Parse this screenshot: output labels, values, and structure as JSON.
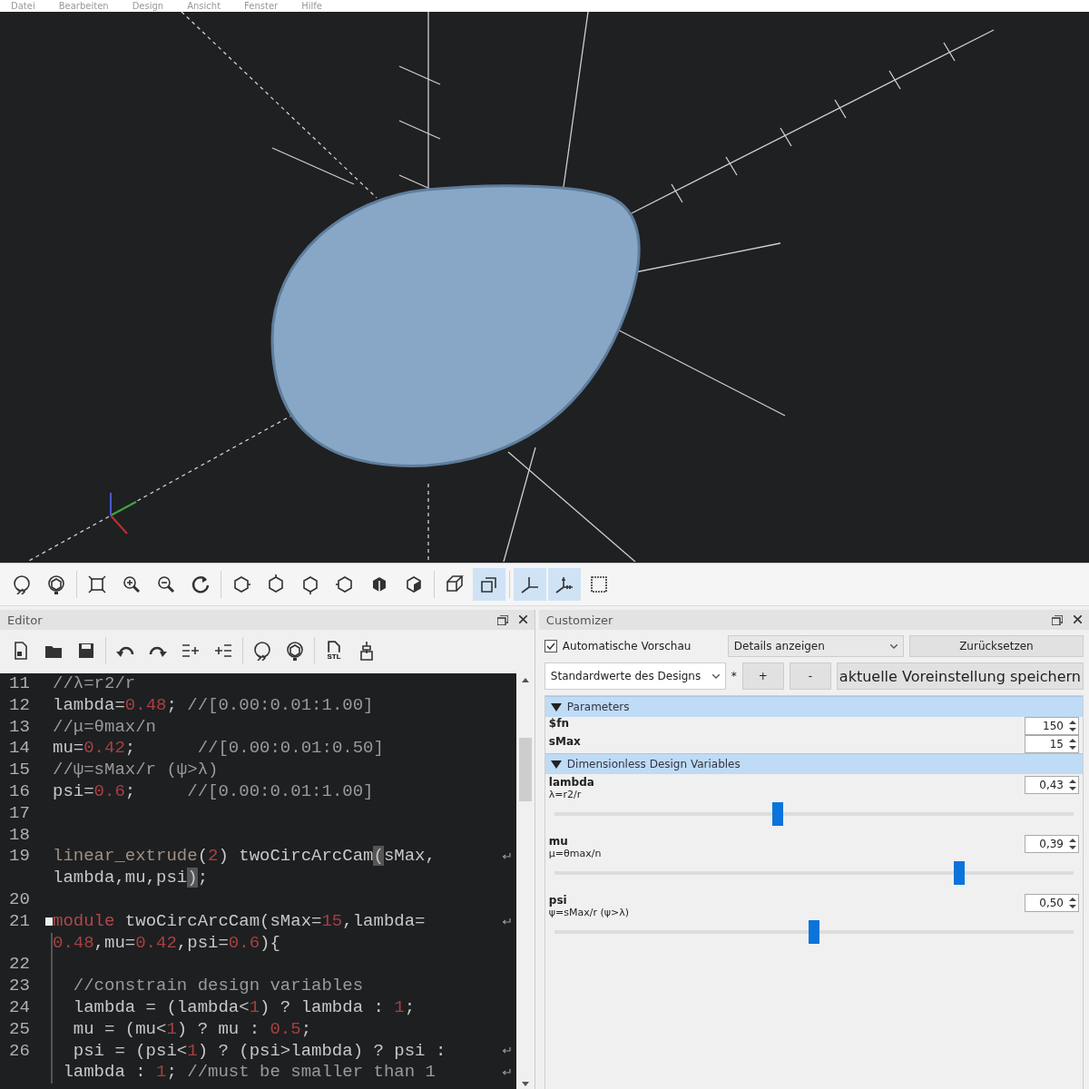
{
  "menu": [
    "Datei",
    "Bearbeiten",
    "Design",
    "Ansicht",
    "Fenster",
    "Hilfe"
  ],
  "main_toolbar": [
    [
      {
        "kind": "preview",
        "selected": false
      },
      {
        "kind": "render",
        "selected": false
      }
    ],
    [
      {
        "kind": "view-all",
        "selected": false
      },
      {
        "kind": "zoom-in",
        "selected": false
      },
      {
        "kind": "zoom-out",
        "selected": false
      },
      {
        "kind": "reset-view",
        "selected": false
      }
    ],
    [
      {
        "kind": "view-right",
        "selected": false
      },
      {
        "kind": "view-top",
        "selected": false
      },
      {
        "kind": "view-bottom",
        "selected": false
      },
      {
        "kind": "view-left",
        "selected": false
      },
      {
        "kind": "view-front",
        "selected": false
      },
      {
        "kind": "view-back",
        "selected": false
      }
    ],
    [
      {
        "kind": "perspective",
        "selected": false
      },
      {
        "kind": "orthogonal",
        "selected": true
      }
    ],
    [
      {
        "kind": "axes",
        "selected": true
      },
      {
        "kind": "scale-markers",
        "selected": true
      },
      {
        "kind": "edges",
        "selected": false
      }
    ]
  ],
  "editor": {
    "title": "Editor",
    "toolbar": [
      [
        {
          "kind": "new"
        },
        {
          "kind": "open"
        },
        {
          "kind": "save"
        }
      ],
      [
        {
          "kind": "undo"
        },
        {
          "kind": "redo"
        },
        {
          "kind": "unindent"
        },
        {
          "kind": "indent"
        }
      ],
      [
        {
          "kind": "preview"
        },
        {
          "kind": "render"
        }
      ],
      [
        {
          "kind": "export",
          "label": "STL"
        },
        {
          "kind": "print"
        }
      ]
    ],
    "lines": [
      {
        "number": "11",
        "rows": [
          {
            "tokens": [
              {
                "kind": "comment",
                "text": "//λ=r2/r"
              }
            ]
          }
        ]
      },
      {
        "number": "12",
        "rows": [
          {
            "tokens": [
              {
                "kind": "plain",
                "text": "lambda="
              },
              {
                "kind": "number",
                "text": "0.48"
              },
              {
                "kind": "plain",
                "text": "; "
              },
              {
                "kind": "comment",
                "text": "//[0.00:0.01:1.00]"
              }
            ]
          }
        ]
      },
      {
        "number": "13",
        "rows": [
          {
            "tokens": [
              {
                "kind": "comment",
                "text": "//μ=θmax/n"
              }
            ]
          }
        ]
      },
      {
        "number": "14",
        "rows": [
          {
            "tokens": [
              {
                "kind": "plain",
                "text": "mu="
              },
              {
                "kind": "number",
                "text": "0.42"
              },
              {
                "kind": "plain",
                "text": ";      "
              },
              {
                "kind": "comment",
                "text": "//[0.00:0.01:0.50]"
              }
            ]
          }
        ]
      },
      {
        "number": "15",
        "rows": [
          {
            "tokens": [
              {
                "kind": "comment",
                "text": "//ψ=sMax/r (ψ>λ)"
              }
            ]
          }
        ]
      },
      {
        "number": "16",
        "rows": [
          {
            "tokens": [
              {
                "kind": "plain",
                "text": "psi="
              },
              {
                "kind": "number",
                "text": "0.6"
              },
              {
                "kind": "plain",
                "text": ";     "
              },
              {
                "kind": "comment",
                "text": "//[0.00:0.01:1.00]"
              }
            ]
          }
        ]
      },
      {
        "number": "17"
      },
      {
        "number": "18"
      },
      {
        "number": "19",
        "rows": [
          {
            "wrapped": true,
            "tokens": [
              {
                "kind": "builtin",
                "text": "linear_extrude"
              },
              {
                "kind": "plain",
                "text": "("
              },
              {
                "kind": "number",
                "text": "2"
              },
              {
                "kind": "plain",
                "text": ") twoCircArcCam"
              },
              {
                "kind": "match",
                "text": "("
              },
              {
                "kind": "plain",
                "text": "sMax,"
              }
            ]
          },
          {
            "wrapped": false,
            "tokens": [
              {
                "kind": "plain",
                "text": "lambda,mu,psi"
              },
              {
                "kind": "match",
                "text": ")"
              },
              {
                "kind": "plain",
                "text": ";"
              }
            ]
          }
        ]
      },
      {
        "number": "20"
      },
      {
        "number": "21",
        "fold": true,
        "rows": [
          {
            "wrapped": true,
            "tokens": [
              {
                "kind": "keyword",
                "text": "module"
              },
              {
                "kind": "plain",
                "text": " twoCircArcCam(sMax="
              },
              {
                "kind": "number",
                "text": "15"
              },
              {
                "kind": "plain",
                "text": ",lambda="
              }
            ]
          },
          {
            "wrapped": false,
            "tokens": [
              {
                "kind": "number",
                "text": "0.48"
              },
              {
                "kind": "plain",
                "text": ",mu="
              },
              {
                "kind": "number",
                "text": "0.42"
              },
              {
                "kind": "plain",
                "text": ",psi="
              },
              {
                "kind": "number",
                "text": "0.6"
              },
              {
                "kind": "plain",
                "text": "){"
              }
            ]
          }
        ]
      },
      {
        "number": "22"
      },
      {
        "number": "23",
        "rows": [
          {
            "tokens": [
              {
                "kind": "comment",
                "text": "  //constrain design variables"
              }
            ]
          }
        ]
      },
      {
        "number": "24",
        "rows": [
          {
            "tokens": [
              {
                "kind": "plain",
                "text": "  lambda = (lambda<"
              },
              {
                "kind": "number",
                "text": "1"
              },
              {
                "kind": "plain",
                "text": ") ? lambda : "
              },
              {
                "kind": "number",
                "text": "1"
              },
              {
                "kind": "plain",
                "text": ";"
              }
            ]
          }
        ]
      },
      {
        "number": "25",
        "rows": [
          {
            "tokens": [
              {
                "kind": "plain",
                "text": "  mu = (mu<"
              },
              {
                "kind": "number",
                "text": "1"
              },
              {
                "kind": "plain",
                "text": ") ? mu : "
              },
              {
                "kind": "number",
                "text": "0.5"
              },
              {
                "kind": "plain",
                "text": ";"
              }
            ]
          }
        ]
      },
      {
        "number": "26",
        "rows": [
          {
            "wrapped": true,
            "tokens": [
              {
                "kind": "plain",
                "text": "  psi = (psi<"
              },
              {
                "kind": "number",
                "text": "1"
              },
              {
                "kind": "plain",
                "text": ") ? (psi>lambda) ? psi :"
              }
            ]
          },
          {
            "wrapped": true,
            "tokens": [
              {
                "kind": "plain",
                "text": " lambda : "
              },
              {
                "kind": "number",
                "text": "1"
              },
              {
                "kind": "plain",
                "text": "; "
              },
              {
                "kind": "comment",
                "text": "//must be smaller than 1"
              }
            ]
          }
        ]
      }
    ]
  },
  "customizer": {
    "title": "Customizer",
    "auto_preview": {
      "label": "Automatische Vorschau",
      "checked": true
    },
    "details_dropdown": "Details anzeigen",
    "reset_button": "Zurücksetzen",
    "preset_dropdown": "Standardwerte des Designs",
    "modified_mark": "*",
    "add_button": "+",
    "remove_button": "-",
    "save_preset_button": "aktuelle Voreinstellung speichern",
    "groups": [
      {
        "title": "Parameters",
        "expanded": true,
        "params": [
          {
            "kind": "spin",
            "name": "$fn",
            "value": "150"
          },
          {
            "kind": "spin",
            "name": "sMax",
            "value": "15"
          }
        ]
      },
      {
        "title": "Dimensionless Design Variables",
        "expanded": true,
        "params": [
          {
            "kind": "slider",
            "name": "lambda",
            "description": "λ=r2/r",
            "value": "0,43",
            "level": 0.43
          },
          {
            "kind": "slider",
            "name": "mu",
            "description": "μ=θmax/n",
            "value": "0,39",
            "level": 0.78
          },
          {
            "kind": "slider",
            "name": "psi",
            "description": "ψ=sMax/r (ψ>λ)",
            "value": "0,50",
            "level": 0.5
          }
        ]
      }
    ]
  }
}
